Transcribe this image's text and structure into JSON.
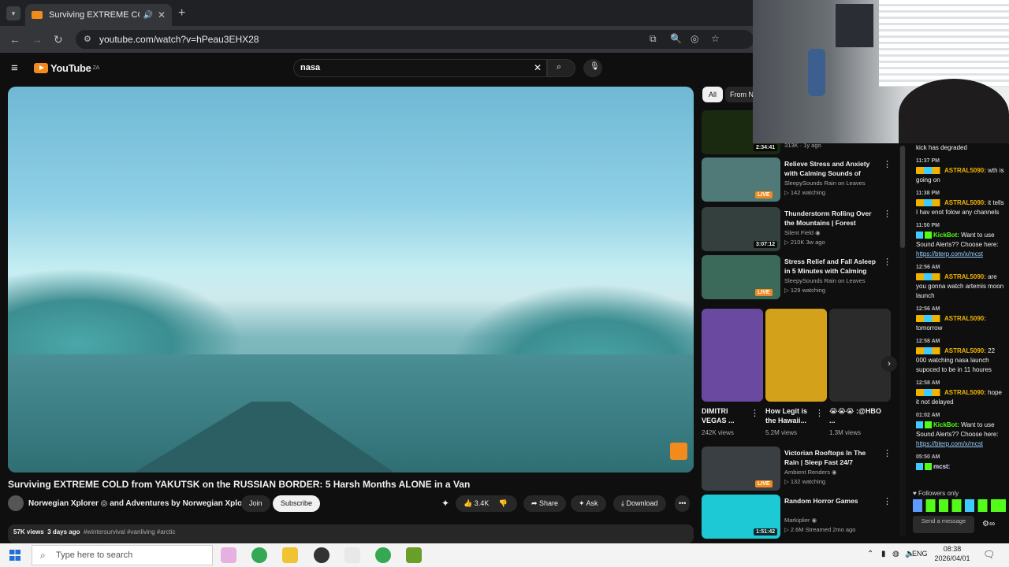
{
  "browser": {
    "tab_title": "Surviving EXTREME COLD fr",
    "tab_audio_icon": "speaker-icon",
    "tab_close": "✕",
    "new_tab": "+",
    "url": "youtube.com/watch?v=hPeau3EHX28"
  },
  "youtube": {
    "logo_text": "YouTube",
    "logo_region": "ZA",
    "search_value": "nasa",
    "video": {
      "title": "Surviving EXTREME COLD from YAKUTSK on the RUSSIAN BORDER: 5 Harsh Months ALONE in a Van",
      "channel": "Norwegian Xplorer ◎ and Adventures by Norwegian Xplorer",
      "join_label": "Join",
      "subscribe_label": "Subscribe",
      "like_count": "3.4K",
      "share_label": "Share",
      "ask_label": "Ask",
      "download_label": "Download",
      "more_label": "•••",
      "views": "57K views",
      "age": "3 days ago",
      "tags": "#wintersurvival #vanliving #arctic"
    },
    "filter_chips": [
      "All",
      "From N"
    ],
    "recommendations": [
      {
        "title": "",
        "channel": "",
        "meta": "313K · 1y ago",
        "duration": "2:34:41",
        "live": false,
        "thumb_color": "#1a2a10"
      },
      {
        "title": "Relieve Stress and Anxiety with Calming Sounds of Pouring ...",
        "channel": "SleepySounds Rain on Leaves",
        "meta": "▷ 142 watching",
        "duration": "LIVE",
        "live": true,
        "thumb_color": "#4f7a78"
      },
      {
        "title": "Thunderstorm Rolling Over the Mountains | Forest Meadow | ...",
        "channel": "Silent Field ◉",
        "meta": "▷ 210K  3w ago",
        "duration": "3:07:12",
        "live": false,
        "thumb_color": "#33403d"
      },
      {
        "title": "Stress Relief and Fall Asleep in 5 Minutes with Calming Rain ...",
        "channel": "SleepySounds Rain on Leaves",
        "meta": "▷ 129 watching",
        "duration": "LIVE",
        "live": true,
        "thumb_color": "#3c6a5a"
      },
      {
        "title": "Victorian Rooftops In The Rain | Sleep Fast 24/7 Livestream",
        "channel": "Ambient Renders ◉",
        "meta": "▷ 132 watching",
        "duration": "LIVE",
        "live": true,
        "thumb_color": "#3a3f44"
      },
      {
        "title": "Random Horror Games",
        "channel": "Markiplier ◉",
        "meta": "▷ 2.6M  Streamed 2mo ago",
        "duration": "1:51:42",
        "live": false,
        "thumb_color": "#1ec9d6"
      }
    ],
    "shorts": [
      {
        "title": "DIMITRI VEGAS ...",
        "views": "242K views",
        "color": "#6a4aa0"
      },
      {
        "title": "How Legit is the Hawaii...",
        "views": "5.2M views",
        "color": "#d4a21a"
      },
      {
        "title": "😭😭😭 :@HBO ...",
        "views": "1.3M views",
        "color": "#2b2b2b"
      }
    ]
  },
  "chat": {
    "messages": [
      {
        "time": "",
        "user": "",
        "text": "kick has degraded",
        "user_class": ""
      },
      {
        "time": "11:37 PM",
        "user": "ASTRAL5090:",
        "text": "wth is going on",
        "user_class": "u-a"
      },
      {
        "time": "11:38 PM",
        "user": "ASTRAL5090:",
        "text": "it tells I hav enot folow any channels",
        "user_class": "u-a"
      },
      {
        "time": "11:50 PM",
        "user": "KickBot:",
        "text": "Want to use Sound Alerts?? Choose here:",
        "link": "https://bterp.com/x/mcst",
        "user_class": "u-k"
      },
      {
        "time": "12:56 AM",
        "user": "ASTRAL5090:",
        "text": "are you gonna watch artemis moon launch",
        "user_class": "u-a"
      },
      {
        "time": "12:56 AM",
        "user": "ASTRAL5090:",
        "text": "tomorrow",
        "user_class": "u-a"
      },
      {
        "time": "12:58 AM",
        "user": "ASTRAL5090:",
        "text": "22 000 watching nasa launch supoced to be in 11 houres",
        "user_class": "u-a"
      },
      {
        "time": "12:58 AM",
        "user": "ASTRAL5090:",
        "text": "hope it not delayed",
        "user_class": "u-a"
      },
      {
        "time": "01:02 AM",
        "user": "KickBot:",
        "text": "Want to use Sound Alerts?? Choose here:",
        "link": "https://bterp.com/x/mcst",
        "user_class": "u-k"
      },
      {
        "time": "05:50 AM",
        "user": "mcst:",
        "text": "",
        "user_class": "u-m"
      }
    ],
    "followers_only": "Followers only",
    "send_placeholder": "Send a message"
  },
  "taskbar": {
    "search_placeholder": "Type here to search",
    "language": "ENG",
    "time": "08:38",
    "date": "2026/04/01"
  }
}
